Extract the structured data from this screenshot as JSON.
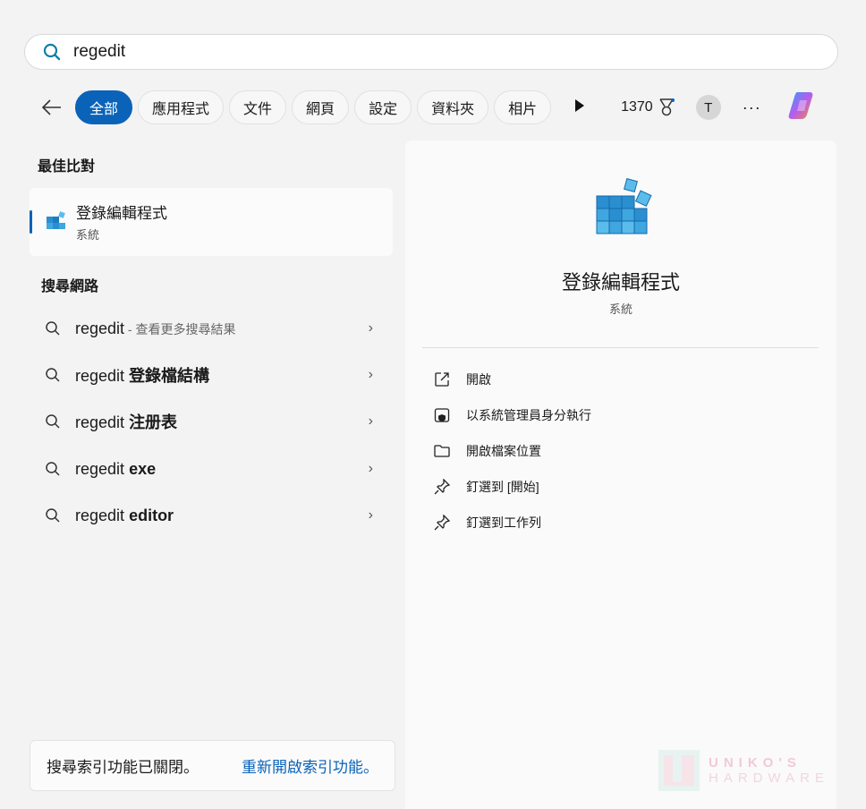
{
  "search": {
    "value": "regedit"
  },
  "filters": {
    "back": "back",
    "chips": [
      "全部",
      "應用程式",
      "文件",
      "網頁",
      "設定",
      "資料夾",
      "相片"
    ],
    "points": "1370",
    "avatar": "T",
    "more": "···"
  },
  "best_match": {
    "heading": "最佳比對",
    "title": "登錄編輯程式",
    "subtitle": "系統"
  },
  "web": {
    "heading": "搜尋網路",
    "items": [
      {
        "q": "regedit",
        "extra": "查看更多搜尋結果",
        "bold": ""
      },
      {
        "q": "regedit",
        "bold": "登錄檔結構"
      },
      {
        "q": "regedit",
        "bold": "注册表"
      },
      {
        "q": "regedit",
        "bold": "exe"
      },
      {
        "q": "regedit",
        "bold": "editor"
      }
    ]
  },
  "detail": {
    "title": "登錄編輯程式",
    "subtitle": "系統",
    "actions": [
      "開啟",
      "以系統管理員身分執行",
      "開啟檔案位置",
      "釘選到 [開始]",
      "釘選到工作列"
    ]
  },
  "footer": {
    "text": "搜尋索引功能已關閉。",
    "link": "重新開啟索引功能。"
  },
  "watermark": {
    "line1": "UNIKO'S",
    "line2": "HARDWARE"
  },
  "colors": {
    "accent": "#0a63b8"
  }
}
